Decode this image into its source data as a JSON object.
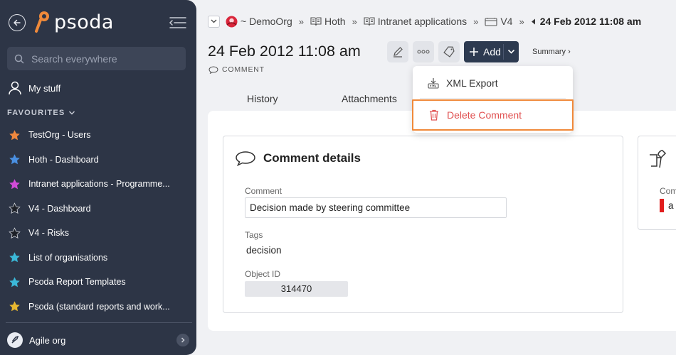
{
  "sidebar": {
    "logo_text": "psoda",
    "search_placeholder": "Search everywhere",
    "my_stuff": "My stuff",
    "favourites_label": "FAVOURITES",
    "favourites": [
      {
        "label": "TestOrg - Users",
        "color": "#f0883e"
      },
      {
        "label": "Hoth - Dashboard",
        "color": "#4a90e2"
      },
      {
        "label": "Intranet applications - Programme...",
        "color": "#d24bd8"
      },
      {
        "label": "V4 - Dashboard",
        "color": "#1c1f26"
      },
      {
        "label": "V4 - Risks",
        "color": "#1c1f26"
      },
      {
        "label": "List of organisations",
        "color": "#3bb8d8"
      },
      {
        "label": "Psoda Report Templates",
        "color": "#3bb8d8"
      },
      {
        "label": "Psoda (standard reports and work...",
        "color": "#e8b830"
      }
    ],
    "org_switch": "Agile org"
  },
  "breadcrumb": {
    "items": [
      "~ DemoOrg",
      "Hoth",
      "Intranet applications",
      "V4"
    ],
    "current": "24 Feb 2012 11:08 am"
  },
  "header": {
    "title": "24 Feb 2012 11:08 am",
    "add_label": "Add",
    "summary_label": "Summary ›",
    "type_label": "COMMENT"
  },
  "tabs": [
    "History",
    "Attachments"
  ],
  "menu": {
    "xml_export": "XML Export",
    "delete": "Delete Comment"
  },
  "details": {
    "title": "Comment details",
    "comment_label": "Comment",
    "comment_value": "Decision made by steering committee",
    "tags_label": "Tags",
    "tags_value": "decision",
    "object_id_label": "Object ID",
    "object_id_value": "314470"
  },
  "right_card": {
    "label": "Com",
    "value": "a"
  }
}
